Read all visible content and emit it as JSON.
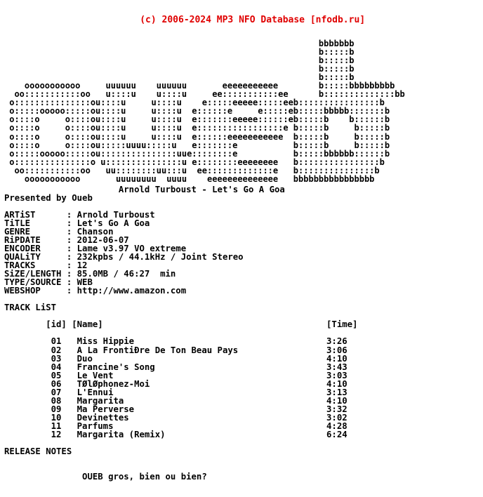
{
  "header": {
    "copyright": "(c) 2006-2024 MP3 NFO Database [nfodb.ru]",
    "color": "#e00000"
  },
  "logo": {
    "description": "ASCII art spelling OUEB",
    "lines": [
      "                                                              bbbbbbb",
      "                                                              b:::::b",
      "                                                              b:::::b",
      "                                                              b:::::b",
      "                                                              b:::::b",
      "    ooooooooooo     uuuuuu    uuuuuu       eeeeeeeeeee        b:::::bbbbbbbbb",
      "  oo:::::::::::oo   u::::u    u::::u     ee:::::::::::ee      b::::::::::::::bb",
      " o:::::::::::::::ou::::u     u::::u    e:::::eeeee:::::eeb::::::::::::::::b",
      " o:::::ooooo:::::ou::::u     u::::u  e::::::e     e:::::eb:::::bbbbb:::::::b",
      " o::::o     o::::ou::::u     u::::u  e:::::::eeeee::::::eb:::::b    b::::::b",
      " o::::o     o::::ou::::u     u::::u  e:::::::::::::::::e b:::::b     b:::::b",
      " o::::o     o::::ou::::u     u::::u  e::::::eeeeeeeeeee  b:::::b     b:::::b",
      " o::::o     o::::ou:::::uuuu:::::u   e:::::::e           b:::::b     b:::::b",
      " o:::::ooooo:::::ou:::::::::::::::uue::::::::e           b:::::bbbbbb::::::b",
      " o:::::::::::::::o u:::::::::::::::u e::::::::eeeeeeee   b::::::::::::::::b",
      "  oo:::::::::::oo   uu::::::::uu:::u  ee:::::::::::::e   b:::::::::::::::b",
      "    ooooooooooo       uuuuuuuu  uuuu    eeeeeeeeeeeeee   bbbbbbbbbbbbbbbb"
    ]
  },
  "release_title": "Arnold Turboust - Let's Go A Goa",
  "presented_by": "Presented by Oueb",
  "info": {
    "rows": [
      {
        "label": "ARTiST",
        "sep": ":",
        "value": "Arnold Turboust"
      },
      {
        "label": "TiTLE",
        "sep": ":",
        "value": "Let's Go A Goa"
      },
      {
        "label": "GENRE",
        "sep": ":",
        "value": "Chanson"
      },
      {
        "label": "RiPDATE",
        "sep": ":",
        "value": "2012-06-07"
      },
      {
        "label": "ENCODER",
        "sep": ":",
        "value": "Lame v3.97 VO extreme"
      },
      {
        "label": "QUALiTY",
        "sep": ":",
        "value": "232kpbs / 44.1kHz / Joint Stereo"
      },
      {
        "label": "TRACKS",
        "sep": ":",
        "value": "12"
      },
      {
        "label": "SiZE/LENGTH",
        "sep": ":",
        "value": "85.0MB / 46:27  min"
      },
      {
        "label": "TYPE/SOURCE",
        "sep": ":",
        "value": "WEB"
      },
      {
        "label": "WEBSHOP",
        "sep": ":",
        "value": "http://www.amazon.com"
      }
    ]
  },
  "tracklist": {
    "heading": "TRACK LiST",
    "columns": {
      "id": "[id]",
      "name": "[Name]",
      "time": "[Time]"
    },
    "tracks": [
      {
        "id": "01",
        "name": "Miss Hippie",
        "time": "3:26"
      },
      {
        "id": "02",
        "name": "A La FrontiÐre De Ton Beau Pays",
        "time": "3:06"
      },
      {
        "id": "03",
        "name": "Duo",
        "time": "4:10"
      },
      {
        "id": "04",
        "name": "Francine's Song",
        "time": "3:43"
      },
      {
        "id": "05",
        "name": "Le Vent",
        "time": "3:03"
      },
      {
        "id": "06",
        "name": "TØlØphonez-Moi",
        "time": "4:10"
      },
      {
        "id": "07",
        "name": "L'Ennui",
        "time": "3:13"
      },
      {
        "id": "08",
        "name": "Margarita",
        "time": "4:10"
      },
      {
        "id": "09",
        "name": "Ma Perverse",
        "time": "3:32"
      },
      {
        "id": "10",
        "name": "Devinettes",
        "time": "3:02"
      },
      {
        "id": "11",
        "name": "Parfums",
        "time": "4:28"
      },
      {
        "id": "12",
        "name": "Margarita (Remix)",
        "time": "6:24"
      }
    ]
  },
  "release_notes": {
    "heading": "RELEASE NOTES",
    "body": "OUEB gros, bien ou bien?"
  }
}
